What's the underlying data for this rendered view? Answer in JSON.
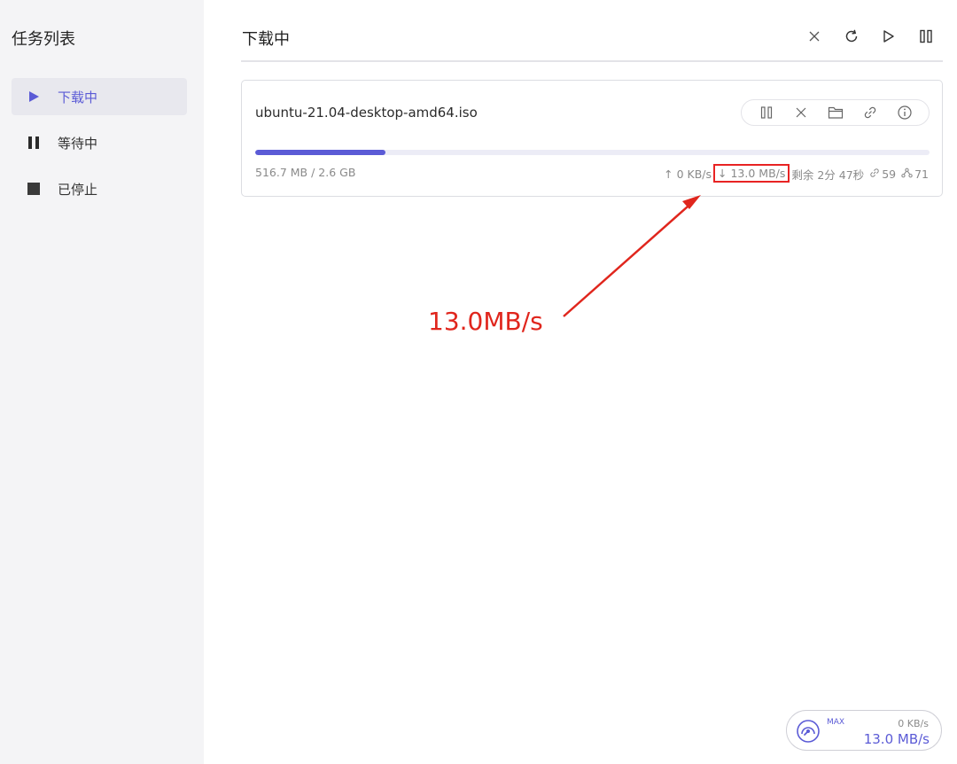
{
  "sidebar": {
    "title": "任务列表",
    "items": [
      {
        "label": "下载中",
        "icon": "play-icon"
      },
      {
        "label": "等待中",
        "icon": "pause-icon"
      },
      {
        "label": "已停止",
        "icon": "stop-icon"
      }
    ]
  },
  "main": {
    "title": "下载中",
    "header_actions": [
      "close-icon",
      "refresh-icon",
      "play-icon",
      "pause-icon"
    ]
  },
  "task": {
    "name": "ubuntu-21.04-desktop-amd64.iso",
    "actions": [
      "pause-icon",
      "close-icon",
      "folder-icon",
      "link-icon",
      "info-icon"
    ],
    "progress": 0.193,
    "size_info": "516.7 MB / 2.6 GB",
    "upload_speed": "↑ 0 KB/s",
    "download_speed": "↓ 13.0 MB/s",
    "remaining": "剩余 2分 47秒",
    "connections": "59",
    "peers": "71"
  },
  "annotation": {
    "label": "13.0MB/s",
    "color": "#e0261d"
  },
  "speedometer": {
    "max_label": "MAX",
    "upload": "0 KB/s",
    "download": "13.0 MB/s"
  },
  "colors": {
    "accent": "#5b5bd6",
    "sidebar_bg": "#f4f4f6",
    "highlight": "#e82323"
  }
}
